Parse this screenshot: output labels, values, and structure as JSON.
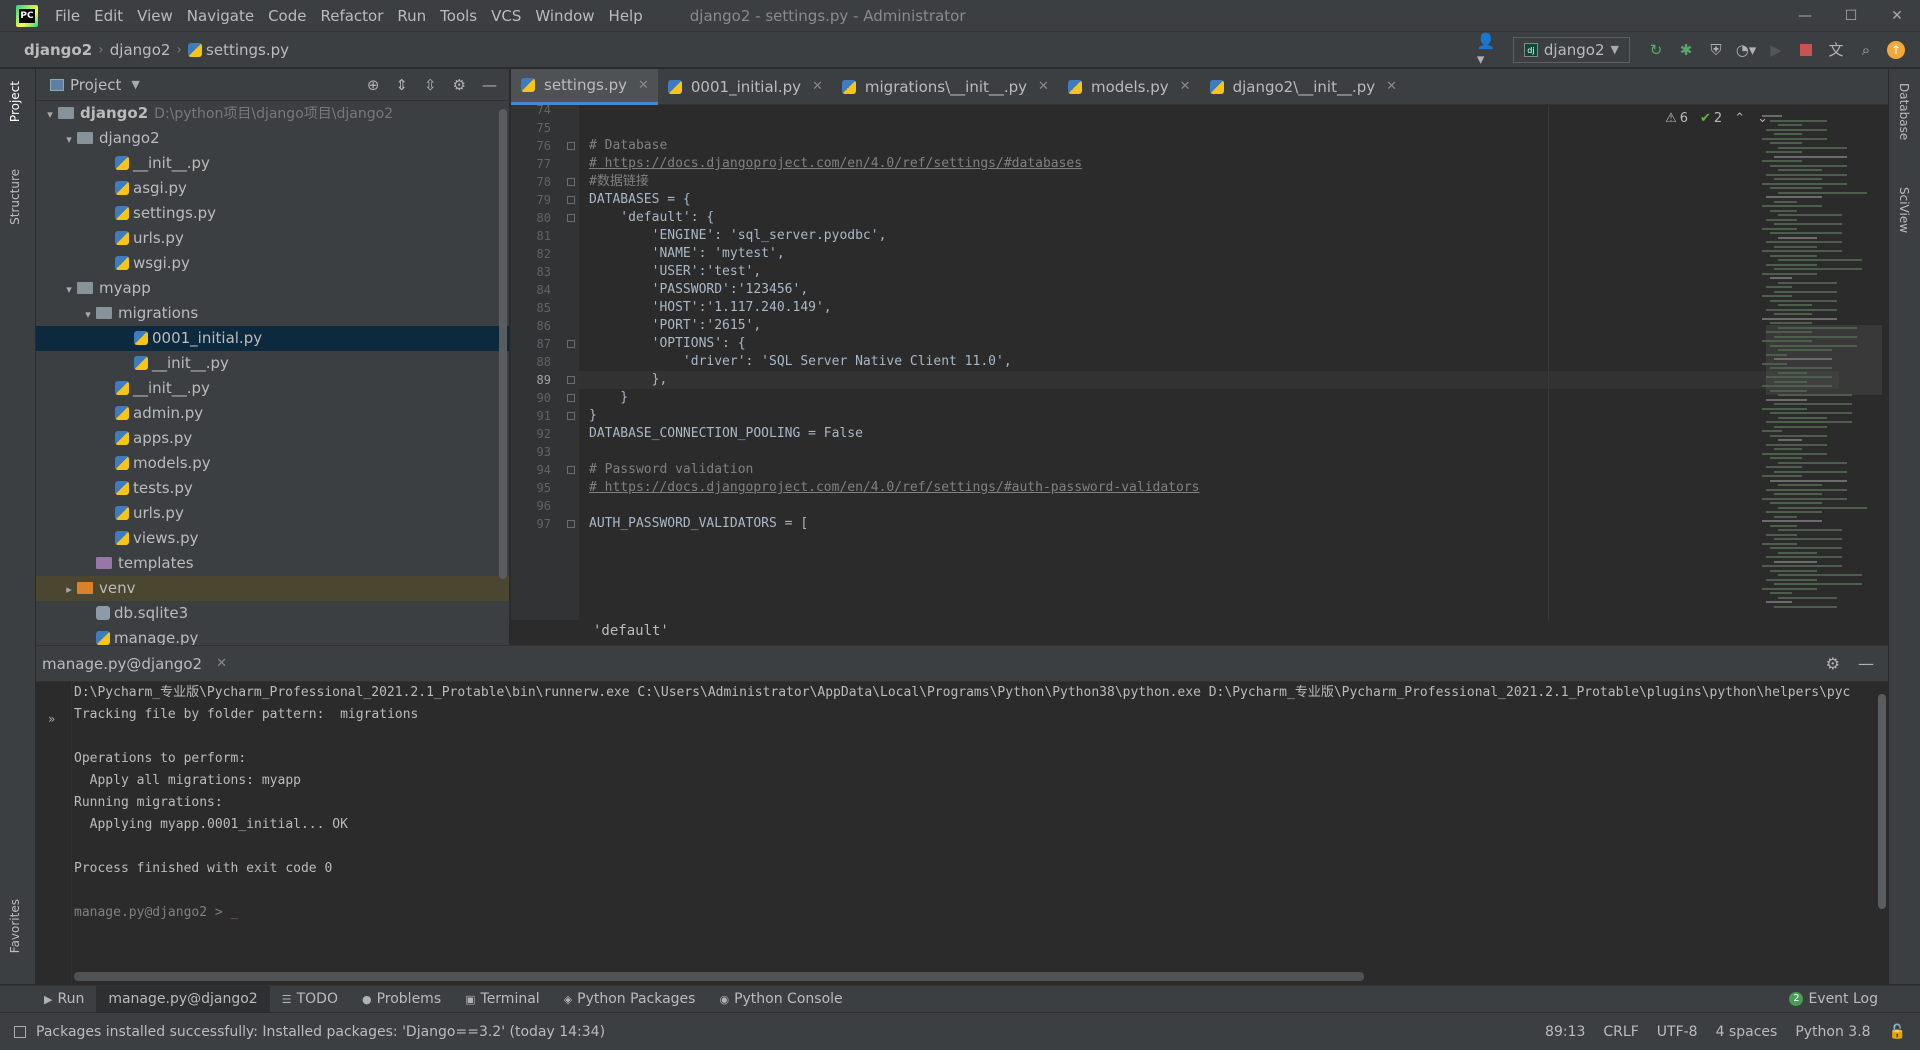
{
  "menu": {
    "items": [
      "File",
      "Edit",
      "View",
      "Navigate",
      "Code",
      "Refactor",
      "Run",
      "Tools",
      "VCS",
      "Window",
      "Help"
    ],
    "title": "django2 - settings.py - Administrator"
  },
  "nav": {
    "crumbs": [
      "django2",
      "django2",
      "settings.py"
    ],
    "run_config": "django2"
  },
  "left_stripe": {
    "project": "Project",
    "structure": "Structure",
    "favorites": "Favorites"
  },
  "right_stripe": {
    "database": "Database",
    "sciview": "SciView"
  },
  "project": {
    "title": "Project",
    "tree": [
      {
        "label": "django2",
        "path": "D:\\python项目\\django项目\\django2",
        "depth": 0,
        "kind": "folder",
        "arrow": "▾"
      },
      {
        "label": "django2",
        "depth": 1,
        "kind": "folder",
        "arrow": "▾"
      },
      {
        "label": "__init__.py",
        "depth": 3,
        "kind": "py"
      },
      {
        "label": "asgi.py",
        "depth": 3,
        "kind": "py"
      },
      {
        "label": "settings.py",
        "depth": 3,
        "kind": "py"
      },
      {
        "label": "urls.py",
        "depth": 3,
        "kind": "py"
      },
      {
        "label": "wsgi.py",
        "depth": 3,
        "kind": "py"
      },
      {
        "label": "myapp",
        "depth": 1,
        "kind": "folder",
        "arrow": "▾"
      },
      {
        "label": "migrations",
        "depth": 2,
        "kind": "folder",
        "arrow": "▾"
      },
      {
        "label": "0001_initial.py",
        "depth": 4,
        "kind": "py",
        "selected": true
      },
      {
        "label": "__init__.py",
        "depth": 4,
        "kind": "py"
      },
      {
        "label": "__init__.py",
        "depth": 3,
        "kind": "py"
      },
      {
        "label": "admin.py",
        "depth": 3,
        "kind": "py"
      },
      {
        "label": "apps.py",
        "depth": 3,
        "kind": "py"
      },
      {
        "label": "models.py",
        "depth": 3,
        "kind": "py"
      },
      {
        "label": "tests.py",
        "depth": 3,
        "kind": "py"
      },
      {
        "label": "urls.py",
        "depth": 3,
        "kind": "py"
      },
      {
        "label": "views.py",
        "depth": 3,
        "kind": "py"
      },
      {
        "label": "templates",
        "depth": 2,
        "kind": "tmpl"
      },
      {
        "label": "venv",
        "depth": 1,
        "kind": "venv",
        "arrow": "▸"
      },
      {
        "label": "db.sqlite3",
        "depth": 2,
        "kind": "db"
      },
      {
        "label": "manage.py",
        "depth": 2,
        "kind": "py"
      }
    ]
  },
  "tabs": [
    {
      "label": "settings.py",
      "active": true
    },
    {
      "label": "0001_initial.py"
    },
    {
      "label": "migrations\\__init__.py"
    },
    {
      "label": "models.py"
    },
    {
      "label": "django2\\__init__.py"
    }
  ],
  "editor": {
    "inspections": {
      "warnings": "6",
      "ok": "2"
    },
    "current_line": 89,
    "lines": [
      {
        "n": 74,
        "t": ""
      },
      {
        "n": 75,
        "t": ""
      },
      {
        "n": 76,
        "t": "# Database",
        "c": "com",
        "fold": true
      },
      {
        "n": 77,
        "t": "# https://docs.djangoproject.com/en/4.0/ref/settings/#databases",
        "c": "link"
      },
      {
        "n": 78,
        "t": "#数据链接",
        "c": "com",
        "fold": true
      },
      {
        "n": 79,
        "t": "DATABASES = {",
        "fold": true
      },
      {
        "n": 80,
        "t": "    'default': {",
        "fold": true
      },
      {
        "n": 81,
        "t": "        'ENGINE': 'sql_server.pyodbc',"
      },
      {
        "n": 82,
        "t": "        'NAME': 'mytest',"
      },
      {
        "n": 83,
        "t": "        'USER':'test',"
      },
      {
        "n": 84,
        "t": "        'PASSWORD':'123456',"
      },
      {
        "n": 85,
        "t": "        'HOST':'1.117.240.149',"
      },
      {
        "n": 86,
        "t": "        'PORT':'2615',"
      },
      {
        "n": 87,
        "t": "        'OPTIONS': {",
        "fold": true
      },
      {
        "n": 88,
        "t": "            'driver': 'SQL Server Native Client 11.0',"
      },
      {
        "n": 89,
        "t": "        },",
        "fold": true
      },
      {
        "n": 90,
        "t": "    }",
        "fold": true
      },
      {
        "n": 91,
        "t": "}",
        "fold": true
      },
      {
        "n": 92,
        "t": "DATABASE_CONNECTION_POOLING = False",
        "c": "bool"
      },
      {
        "n": 93,
        "t": ""
      },
      {
        "n": 94,
        "t": "# Password validation",
        "c": "com",
        "fold": true
      },
      {
        "n": 95,
        "t": "# https://docs.djangoproject.com/en/4.0/ref/settings/#auth-password-validators",
        "c": "link"
      },
      {
        "n": 96,
        "t": ""
      },
      {
        "n": 97,
        "t": "AUTH_PASSWORD_VALIDATORS = [",
        "fold": true
      }
    ],
    "breadcrumb_hint": "'default'"
  },
  "run": {
    "tab": "manage.py@django2",
    "console": [
      "D:\\Pycharm_专业版\\Pycharm_Professional_2021.2.1_Protable\\bin\\runnerw.exe C:\\Users\\Administrator\\AppData\\Local\\Programs\\Python\\Python38\\python.exe D:\\Pycharm_专业版\\Pycharm_Professional_2021.2.1_Protable\\plugins\\python\\helpers\\pyc",
      "Tracking file by folder pattern:  migrations",
      "",
      "Operations to perform:",
      "  Apply all migrations: myapp",
      "Running migrations:",
      "  Applying myapp.0001_initial... OK",
      "",
      "Process finished with exit code 0",
      ""
    ],
    "prompt": "manage.py@django2 > "
  },
  "bottom_tabs": [
    "Run",
    "manage.py@django2",
    "TODO",
    "Problems",
    "Terminal",
    "Python Packages",
    "Python Console"
  ],
  "bottom_icons": [
    "run-icon",
    "",
    "todo-icon",
    "problems-icon",
    "terminal-icon",
    "packages-icon",
    "console-icon"
  ],
  "event_log": {
    "count": "2",
    "label": "Event Log"
  },
  "status": {
    "message": "Packages installed successfully: Installed packages: 'Django==3.2' (today 14:34)",
    "position": "89:13",
    "line_sep": "CRLF",
    "encoding": "UTF-8",
    "indent": "4 spaces",
    "interpreter": "Python 3.8"
  }
}
